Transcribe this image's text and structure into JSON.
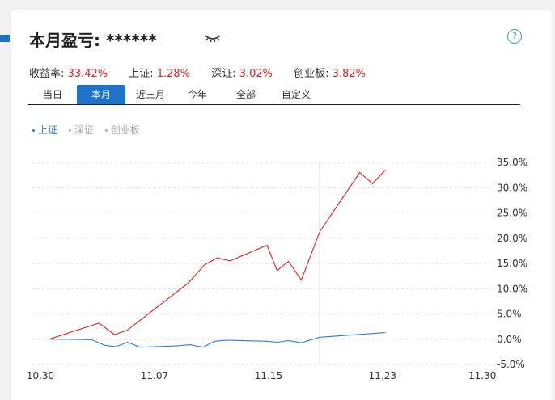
{
  "header": {
    "title": "本月盈亏: ******",
    "eye_icon": "eye-closed-icon",
    "help_label": "?"
  },
  "stats": [
    {
      "label": "收益率: ",
      "value": "33.42%"
    },
    {
      "label": "上证: ",
      "value": "1.28%"
    },
    {
      "label": "深证: ",
      "value": "3.02%"
    },
    {
      "label": "创业板: ",
      "value": "3.82%"
    }
  ],
  "tabs": [
    {
      "label": "当日",
      "active": false
    },
    {
      "label": "本月",
      "active": true
    },
    {
      "label": "近三月",
      "active": false
    },
    {
      "label": "今年",
      "active": false
    },
    {
      "label": "全部",
      "active": false
    },
    {
      "label": "自定义",
      "active": false
    }
  ],
  "legend": [
    {
      "label": "上证",
      "active": true
    },
    {
      "label": "深证",
      "active": false
    },
    {
      "label": "创业板",
      "active": false
    }
  ],
  "colors": {
    "accent": "#1e73c8",
    "portfolio_line": "#e02020",
    "index_line": "#2a7fd4",
    "positive": "#e02020"
  },
  "chart_data": {
    "type": "line",
    "x_ticks": [
      "10.30",
      "11.07",
      "11.15",
      "11.23",
      "11.30"
    ],
    "x_tick_days": [
      0,
      8,
      16,
      24,
      31
    ],
    "y_ticks": [
      "35.0%",
      "30.0%",
      "25.0%",
      "20.0%",
      "15.0%",
      "10.0%",
      "5.0%",
      "0.0%",
      "-5.0%"
    ],
    "ylim": [
      -5,
      35
    ],
    "xlim_days": [
      0,
      31
    ],
    "grid": true,
    "y_axis_position": "right",
    "crosshair_day": 19.6,
    "series": [
      {
        "role": "portfolio",
        "x_days": [
          0.6,
          4.1,
          5.2,
          6.1,
          10.4,
          11.5,
          12.4,
          13.3,
          15.9,
          16.6,
          17.4,
          18.3,
          19.6,
          22.4,
          23.3,
          24.2
        ],
        "values": [
          0.0,
          3.2,
          0.9,
          1.8,
          11.2,
          14.7,
          16.1,
          15.5,
          18.6,
          13.6,
          15.4,
          11.7,
          21.3,
          33.0,
          30.8,
          33.5
        ]
      },
      {
        "role": "index",
        "x_days": [
          0.6,
          1.8,
          3.6,
          4.5,
          5.3,
          6.1,
          7.0,
          9.6,
          10.5,
          11.4,
          12.2,
          13.1,
          14.2,
          15.9,
          16.6,
          17.4,
          18.3,
          19.6,
          24.2
        ],
        "values": [
          0.0,
          0.0,
          -0.1,
          -1.2,
          -1.5,
          -0.6,
          -1.6,
          -1.3,
          -1.1,
          -1.6,
          -0.4,
          -0.2,
          -0.3,
          -0.4,
          -0.6,
          -0.3,
          -0.7,
          0.4,
          1.3
        ]
      }
    ]
  }
}
